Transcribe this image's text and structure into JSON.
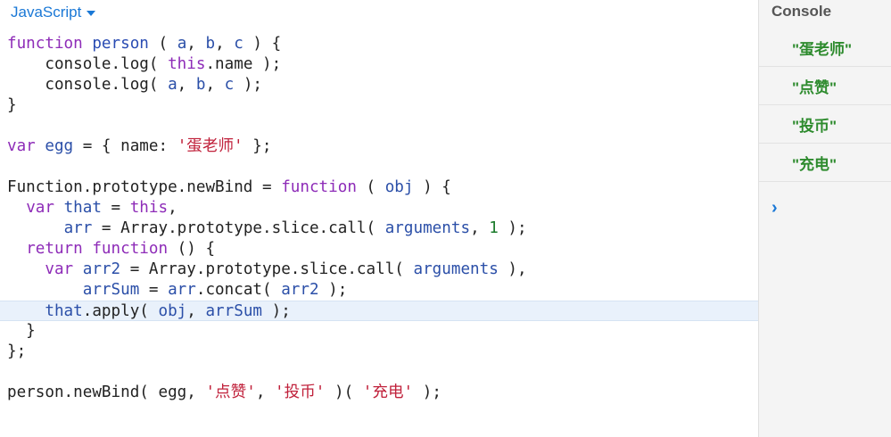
{
  "editor": {
    "language": "JavaScript",
    "lines": [
      [
        {
          "t": "function",
          "c": "kw"
        },
        {
          "t": " ",
          "c": "plain"
        },
        {
          "t": "person",
          "c": "fn"
        },
        {
          "t": " ( ",
          "c": "plain"
        },
        {
          "t": "a",
          "c": "var"
        },
        {
          "t": ", ",
          "c": "plain"
        },
        {
          "t": "b",
          "c": "var"
        },
        {
          "t": ", ",
          "c": "plain"
        },
        {
          "t": "c",
          "c": "var"
        },
        {
          "t": " ) {",
          "c": "plain"
        }
      ],
      [
        {
          "t": "    console.log( ",
          "c": "plain"
        },
        {
          "t": "this",
          "c": "kw"
        },
        {
          "t": ".name );",
          "c": "plain"
        }
      ],
      [
        {
          "t": "    console.log( ",
          "c": "plain"
        },
        {
          "t": "a",
          "c": "var"
        },
        {
          "t": ", ",
          "c": "plain"
        },
        {
          "t": "b",
          "c": "var"
        },
        {
          "t": ", ",
          "c": "plain"
        },
        {
          "t": "c",
          "c": "var"
        },
        {
          "t": " );",
          "c": "plain"
        }
      ],
      [
        {
          "t": "}",
          "c": "plain"
        }
      ],
      [],
      [
        {
          "t": "var",
          "c": "kw"
        },
        {
          "t": " ",
          "c": "plain"
        },
        {
          "t": "egg",
          "c": "var"
        },
        {
          "t": " = { name: ",
          "c": "plain"
        },
        {
          "t": "'蛋老师'",
          "c": "str"
        },
        {
          "t": " };",
          "c": "plain"
        }
      ],
      [],
      [
        {
          "t": "Function.prototype.newBind = ",
          "c": "plain"
        },
        {
          "t": "function",
          "c": "kw"
        },
        {
          "t": " ( ",
          "c": "plain"
        },
        {
          "t": "obj",
          "c": "var"
        },
        {
          "t": " ) {",
          "c": "plain"
        }
      ],
      [
        {
          "t": "  ",
          "c": "plain"
        },
        {
          "t": "var",
          "c": "kw"
        },
        {
          "t": " ",
          "c": "plain"
        },
        {
          "t": "that",
          "c": "var"
        },
        {
          "t": " = ",
          "c": "plain"
        },
        {
          "t": "this",
          "c": "kw"
        },
        {
          "t": ",",
          "c": "plain"
        }
      ],
      [
        {
          "t": "      ",
          "c": "plain"
        },
        {
          "t": "arr",
          "c": "var"
        },
        {
          "t": " = Array.prototype.slice.call( ",
          "c": "plain"
        },
        {
          "t": "arguments",
          "c": "var"
        },
        {
          "t": ", ",
          "c": "plain"
        },
        {
          "t": "1",
          "c": "num"
        },
        {
          "t": " );",
          "c": "plain"
        }
      ],
      [
        {
          "t": "  ",
          "c": "plain"
        },
        {
          "t": "return",
          "c": "kw"
        },
        {
          "t": " ",
          "c": "plain"
        },
        {
          "t": "function",
          "c": "kw"
        },
        {
          "t": " () {",
          "c": "plain"
        }
      ],
      [
        {
          "t": "    ",
          "c": "plain"
        },
        {
          "t": "var",
          "c": "kw"
        },
        {
          "t": " ",
          "c": "plain"
        },
        {
          "t": "arr2",
          "c": "var"
        },
        {
          "t": " = Array.prototype.slice.call( ",
          "c": "plain"
        },
        {
          "t": "arguments",
          "c": "var"
        },
        {
          "t": " ),",
          "c": "plain"
        }
      ],
      [
        {
          "t": "        ",
          "c": "plain"
        },
        {
          "t": "arrSum",
          "c": "var"
        },
        {
          "t": " = ",
          "c": "plain"
        },
        {
          "t": "arr",
          "c": "var"
        },
        {
          "t": ".concat( ",
          "c": "plain"
        },
        {
          "t": "arr2",
          "c": "var"
        },
        {
          "t": " );",
          "c": "plain"
        }
      ],
      [
        {
          "t": "    ",
          "c": "plain"
        },
        {
          "t": "that",
          "c": "var"
        },
        {
          "t": ".apply( ",
          "c": "plain"
        },
        {
          "t": "obj",
          "c": "var"
        },
        {
          "t": ", ",
          "c": "plain"
        },
        {
          "t": "arrSum",
          "c": "var"
        },
        {
          "t": " );",
          "c": "plain"
        }
      ],
      [
        {
          "t": "  }",
          "c": "plain"
        }
      ],
      [
        {
          "t": "};",
          "c": "plain"
        }
      ],
      [],
      [
        {
          "t": "person.newBind( egg, ",
          "c": "plain"
        },
        {
          "t": "'点赞'",
          "c": "str"
        },
        {
          "t": ", ",
          "c": "plain"
        },
        {
          "t": "'投币'",
          "c": "str"
        },
        {
          "t": " )( ",
          "c": "plain"
        },
        {
          "t": "'充电'",
          "c": "str"
        },
        {
          "t": " );",
          "c": "plain"
        }
      ]
    ],
    "active_line": 13
  },
  "console": {
    "title": "Console",
    "entries": [
      "\"蛋老师\"",
      "\"点赞\"",
      "\"投币\"",
      "\"充电\""
    ],
    "prompt_icon": "chevron-right-icon",
    "prompt_glyph": "›"
  },
  "colors": {
    "accent": "#1a78d6",
    "keyword": "#8e2cb8",
    "string": "#c0213b",
    "console_text": "#2e8b2e"
  }
}
